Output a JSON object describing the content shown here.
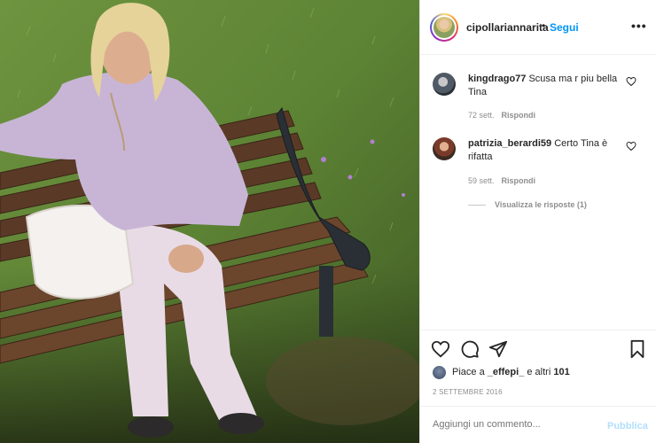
{
  "post": {
    "photo_icon": "photo-of-woman-on-park-bench",
    "owner": "cipollariannarita",
    "dot": "•",
    "follow_label": "Segui",
    "more_label": "•••"
  },
  "comments": [
    {
      "username": "kingdrago77",
      "text": "Scusa ma r piu bella Tina",
      "time": "72 sett.",
      "reply_label": "Rispondi"
    },
    {
      "username": "patrizia_berardi59",
      "text": "Certo Tina è rifatta",
      "time": "59 sett.",
      "reply_label": "Rispondi"
    }
  ],
  "view_replies": "Visualizza le risposte (1)",
  "likes": {
    "prefix": "Piace a ",
    "user": "_effepi_",
    "middle": " e altri ",
    "count": "101"
  },
  "date": "2 SETTEMBRE 2016",
  "add_comment": {
    "placeholder": "Aggiungi un commento...",
    "publish_label": "Pubblica"
  },
  "colors": {
    "accent": "#0095f6",
    "publish_disabled": "#b2dffc",
    "meta": "#8e8e8e"
  }
}
